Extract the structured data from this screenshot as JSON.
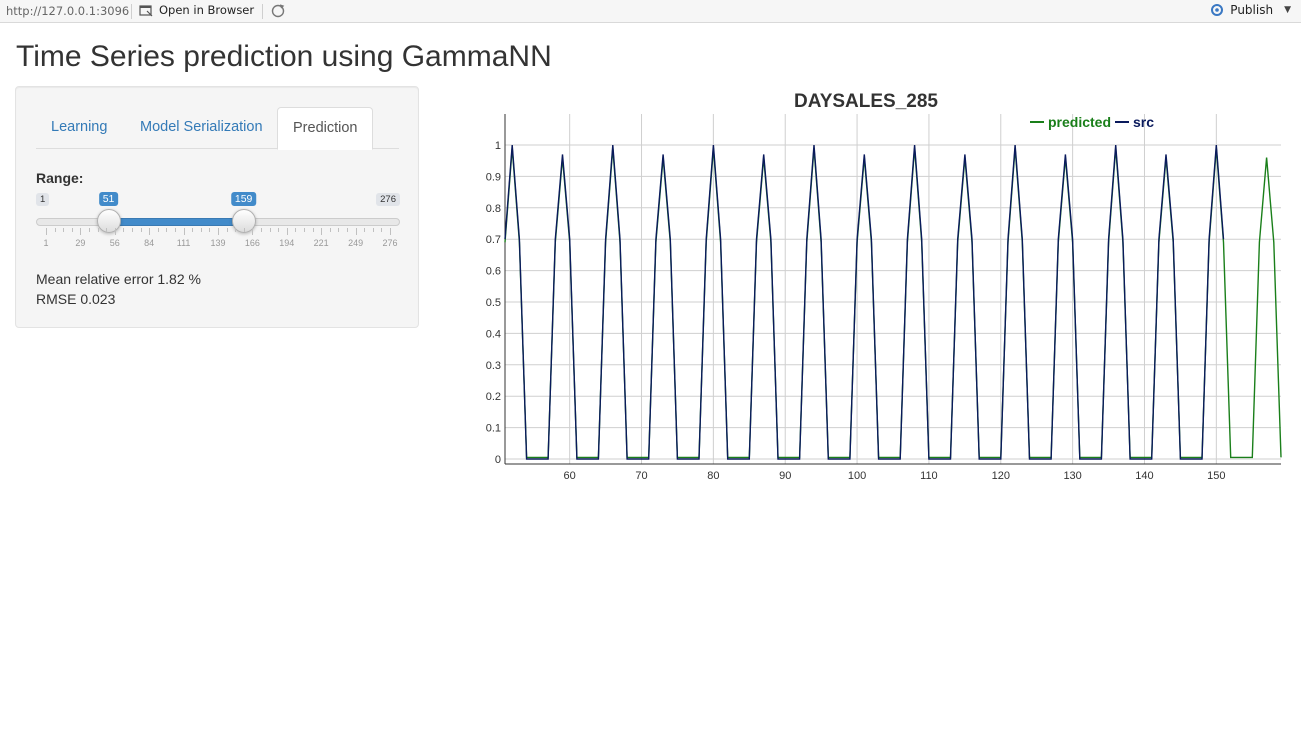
{
  "viewer": {
    "url": "http://127.0.0.1:3096",
    "open_in_browser": "Open in Browser",
    "publish": "Publish"
  },
  "page": {
    "title": "Time Series prediction using GammaNN"
  },
  "sidebar": {
    "tabs": [
      {
        "label": "Learning",
        "active": false
      },
      {
        "label": "Model Serialization",
        "active": false
      },
      {
        "label": "Prediction",
        "active": true
      }
    ],
    "range": {
      "label": "Range:",
      "min": 1,
      "max": 276,
      "from": 51,
      "to": 159,
      "min_label": "1",
      "max_label": "276",
      "from_label": "51",
      "to_label": "159",
      "grid_labels": [
        "1",
        "29",
        "56",
        "84",
        "111",
        "139",
        "166",
        "194",
        "221",
        "249",
        "276"
      ]
    },
    "stats": {
      "mean_relative_error": "Mean relative error 1.82 %",
      "rmse": "RMSE 0.023"
    }
  },
  "chart_data": {
    "type": "line",
    "title": "DAYSALES_285",
    "xlabel": "",
    "ylabel": "",
    "xlim": [
      51,
      159
    ],
    "ylim": [
      0,
      1
    ],
    "x_ticks": [
      "60",
      "70",
      "80",
      "90",
      "100",
      "110",
      "120",
      "130",
      "140",
      "150"
    ],
    "y_ticks": [
      "0",
      "0.1",
      "0.2",
      "0.3",
      "0.4",
      "0.5",
      "0.6",
      "0.7",
      "0.8",
      "0.9",
      "1"
    ],
    "legend": {
      "position": "top-right",
      "items": [
        "predicted",
        "src"
      ]
    },
    "colors": {
      "predicted": "#1a7f1a",
      "src": "#0a1a5c"
    },
    "pattern": {
      "description_values": "weekly cycle: 0, 0, 0.7, 1, 0.7, 0, 0 repeating",
      "cycle_values": [
        0.7,
        1.0,
        0.7,
        0,
        0,
        0.7,
        0.97,
        0.7,
        0,
        0
      ]
    },
    "series": [
      {
        "name": "predicted",
        "x_start": 51,
        "x_end": 159
      },
      {
        "name": "src",
        "x_start": 51,
        "x_end": 151
      }
    ]
  }
}
